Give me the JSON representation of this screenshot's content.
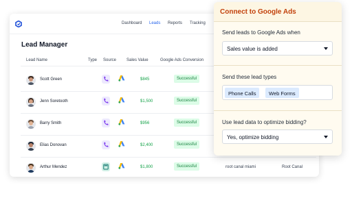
{
  "nav": {
    "links": [
      "Dashboard",
      "Leads",
      "Reports",
      "Tracking"
    ],
    "active": "Leads"
  },
  "leads": {
    "title": "Lead Manager",
    "columns": [
      "Lead Name",
      "Type",
      "Source",
      "Sales Value",
      "Google Ads Conversion"
    ],
    "rows": [
      {
        "name": "Scott Green",
        "type": "phone",
        "value": "$845",
        "status": "Successful",
        "keyword": "",
        "keyword2": ""
      },
      {
        "name": "Jenn Soretooth",
        "type": "phone",
        "value": "$1,500",
        "status": "Successful",
        "keyword": "",
        "keyword2": ""
      },
      {
        "name": "Barry Smith",
        "type": "phone",
        "value": "$956",
        "status": "Successful",
        "keyword": "",
        "keyword2": ""
      },
      {
        "name": "Elias Donovan",
        "type": "phone",
        "value": "$2,400",
        "status": "Successful",
        "keyword": "",
        "keyword2": ""
      },
      {
        "name": "Arthur Mendez",
        "type": "web",
        "value": "$1,800",
        "status": "Successful",
        "keyword": "root canal miami",
        "keyword2": "Root Canal"
      }
    ]
  },
  "connect": {
    "title": "Connect to Google Ads",
    "send_label": "Send leads to Google Ads when",
    "send_value": "Sales value is added",
    "types_label": "Send these lead types",
    "types": [
      "Phone Calls",
      "Web Forms"
    ],
    "optimize_label": "Use lead data to optimize bidding?",
    "optimize_value": "Yes, optimize bidding"
  },
  "colors": {
    "accent": "#2563eb",
    "card_title": "#c2410c",
    "success": "#16a34a",
    "badge_bg": "#dcfce7"
  },
  "icons": {
    "logo": "app-logo-icon",
    "phone": "phone-icon",
    "web": "web-form-icon",
    "source": "google-ads-icon",
    "caret": "chevron-down-icon"
  }
}
